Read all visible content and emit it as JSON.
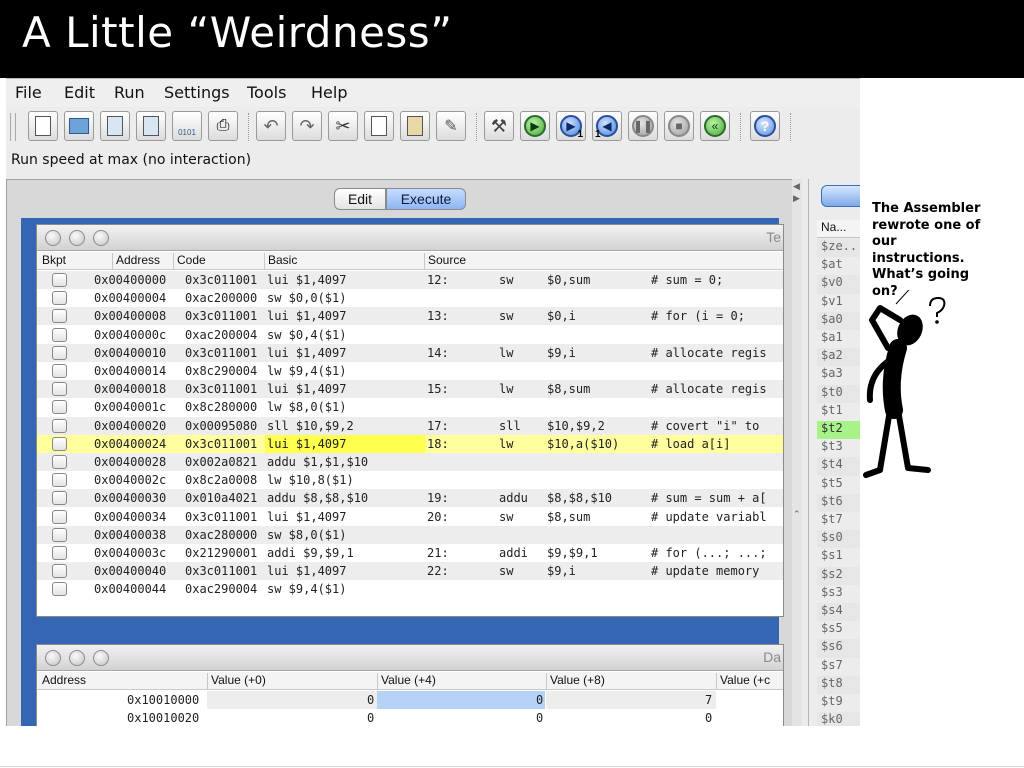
{
  "slide": {
    "title": "A Little “Weirdness”",
    "annotation": "The Assembler rewrote one of our instructions. What’s going on?"
  },
  "menubar": {
    "items": [
      "File",
      "Edit",
      "Run",
      "Settings",
      "Tools",
      "Help"
    ]
  },
  "toolbar": {
    "status": "Run speed at max (no interaction)",
    "dump_label": "0101",
    "step_label": "1",
    "backstep_label": "1"
  },
  "tabs": {
    "edit": "Edit",
    "execute": "Execute"
  },
  "text_segment": {
    "title": "Te",
    "headers": [
      "Bkpt",
      "Address",
      "Code",
      "Basic",
      "Source"
    ],
    "rows": [
      {
        "address": "0x00400000",
        "code": "0x3c011001",
        "basic": "lui $1,4097",
        "line": "12:",
        "op": "sw",
        "args": "$0,sum",
        "comment": "# sum = 0;"
      },
      {
        "address": "0x00400004",
        "code": "0xac200000",
        "basic": "sw $0,0($1)",
        "line": "",
        "op": "",
        "args": "",
        "comment": ""
      },
      {
        "address": "0x00400008",
        "code": "0x3c011001",
        "basic": "lui $1,4097",
        "line": "13:",
        "op": "sw",
        "args": "$0,i",
        "comment": "# for (i = 0;"
      },
      {
        "address": "0x0040000c",
        "code": "0xac200004",
        "basic": "sw $0,4($1)",
        "line": "",
        "op": "",
        "args": "",
        "comment": ""
      },
      {
        "address": "0x00400010",
        "code": "0x3c011001",
        "basic": "lui $1,4097",
        "line": "14:",
        "op": "lw",
        "args": "$9,i",
        "comment": "# allocate regis"
      },
      {
        "address": "0x00400014",
        "code": "0x8c290004",
        "basic": "lw $9,4($1)",
        "line": "",
        "op": "",
        "args": "",
        "comment": ""
      },
      {
        "address": "0x00400018",
        "code": "0x3c011001",
        "basic": "lui $1,4097",
        "line": "15:",
        "op": "lw",
        "args": "$8,sum",
        "comment": "# allocate regis"
      },
      {
        "address": "0x0040001c",
        "code": "0x8c280000",
        "basic": "lw $8,0($1)",
        "line": "",
        "op": "",
        "args": "",
        "comment": ""
      },
      {
        "address": "0x00400020",
        "code": "0x00095080",
        "basic": "sll $10,$9,2",
        "line": "17:",
        "op": "sll",
        "args": "$10,$9,2",
        "comment": "# covert \"i\" to"
      },
      {
        "address": "0x00400024",
        "code": "0x3c011001",
        "basic": "lui $1,4097",
        "line": "18:",
        "op": "lw",
        "args": "$10,a($10)",
        "comment": "# load a[i]"
      },
      {
        "address": "0x00400028",
        "code": "0x002a0821",
        "basic": "addu $1,$1,$10",
        "line": "",
        "op": "",
        "args": "",
        "comment": ""
      },
      {
        "address": "0x0040002c",
        "code": "0x8c2a0008",
        "basic": "lw $10,8($1)",
        "line": "",
        "op": "",
        "args": "",
        "comment": ""
      },
      {
        "address": "0x00400030",
        "code": "0x010a4021",
        "basic": "addu $8,$8,$10",
        "line": "19:",
        "op": "addu",
        "args": "$8,$8,$10",
        "comment": "# sum = sum + a["
      },
      {
        "address": "0x00400034",
        "code": "0x3c011001",
        "basic": "lui $1,4097",
        "line": "20:",
        "op": "sw",
        "args": "$8,sum",
        "comment": "# update variabl"
      },
      {
        "address": "0x00400038",
        "code": "0xac280000",
        "basic": "sw $8,0($1)",
        "line": "",
        "op": "",
        "args": "",
        "comment": ""
      },
      {
        "address": "0x0040003c",
        "code": "0x21290001",
        "basic": "addi $9,$9,1",
        "line": "21:",
        "op": "addi",
        "args": "$9,$9,1",
        "comment": "# for (...; ...;"
      },
      {
        "address": "0x00400040",
        "code": "0x3c011001",
        "basic": "lui $1,4097",
        "line": "22:",
        "op": "sw",
        "args": "$9,i",
        "comment": "# update memory"
      },
      {
        "address": "0x00400044",
        "code": "0xac290004",
        "basic": "sw $9,4($1)",
        "line": "",
        "op": "",
        "args": "",
        "comment": ""
      }
    ],
    "highlighted_row": 9
  },
  "data_segment": {
    "title": "Da",
    "headers": [
      "Address",
      "Value (+0)",
      "Value (+4)",
      "Value (+8)",
      "Value (+c"
    ],
    "rows": [
      {
        "address": "0x10010000",
        "v0": "0",
        "v4": "0",
        "v8": "7"
      },
      {
        "address": "0x10010020",
        "v0": "0",
        "v4": "0",
        "v8": "0"
      }
    ]
  },
  "registers": {
    "header": "Na...",
    "names": [
      "$ze...",
      "$at",
      "$v0",
      "$v1",
      "$a0",
      "$a1",
      "$a2",
      "$a3",
      "$t0",
      "$t1",
      "$t2",
      "$t3",
      "$t4",
      "$t5",
      "$t6",
      "$t7",
      "$s0",
      "$s1",
      "$s2",
      "$s3",
      "$s4",
      "$s5",
      "$s6",
      "$s7",
      "$t8",
      "$t9",
      "$k0"
    ],
    "highlighted": "$t2"
  },
  "colors": {
    "highlight_row": "#ffff9e",
    "highlight_register": "#a8f28a",
    "desktop_blue": "#3466b4",
    "execute_tab": "#8fb6f2"
  }
}
